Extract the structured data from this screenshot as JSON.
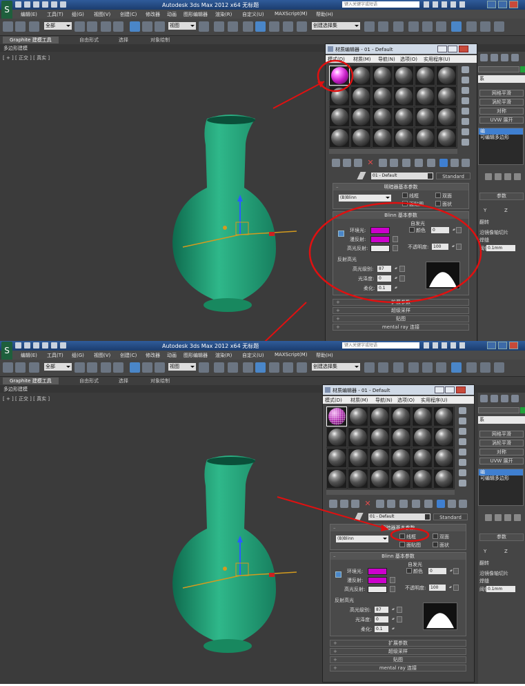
{
  "app_title": "Autodesk 3ds Max  2012 x64   无标题",
  "search_placeholder": "键入关键字或短语",
  "menu": [
    "编辑(E)",
    "工具(T)",
    "组(G)",
    "视图(V)",
    "创建(C)",
    "修改器",
    "动画",
    "图形编辑器",
    "渲染(R)",
    "自定义(U)",
    "MAXScript(M)",
    "帮助(H)"
  ],
  "toolbar": {
    "selection_filter": "全部",
    "ref_coord": "视图",
    "named_selection": "创建选择集"
  },
  "ribbon_tabs": [
    "Graphite 建模工具",
    "自由形式",
    "选择",
    "对象绘制"
  ],
  "ribbon_subtitle": "多边形建模",
  "viewport_label": "[ + ] [ 正交 ] [ 真实 ]",
  "material_editor": {
    "title": "材质编辑器 - 01 - Default",
    "menu": [
      "模式(D)",
      "材质(M)",
      "导航(N)",
      "选项(O)",
      "实用程序(U)"
    ],
    "material_name": "01 - Default",
    "material_type": "Standard",
    "shader_rollout": {
      "title": "明暗器基本参数",
      "shader": "(B)Blinn",
      "wire_label": "线框",
      "two_sided_label": "双面",
      "face_map_label": "面贴图",
      "faceted_label": "面状"
    },
    "blinn_rollout": {
      "title": "Blinn 基本参数",
      "self_illum_title": "自发光",
      "color_label": "颜色",
      "color_value": "0",
      "ambient_label": "环境光:",
      "diffuse_label": "漫反射:",
      "specular_label": "高光反射:",
      "opacity_label": "不透明度:",
      "opacity_value": "100",
      "highlight_title": "反射高光",
      "spec_level_label": "高光级别:",
      "spec_level_value": "87",
      "gloss_label": "光泽度:",
      "gloss_value": "0",
      "soften_label": "柔化:",
      "soften_value": "0.1"
    },
    "collapsed_rollouts": [
      "扩展参数",
      "超级采样",
      "贴图",
      "mental ray 连接"
    ]
  },
  "command_panel": {
    "modifier_list_label": "系",
    "buttons": [
      "网格平滑",
      "涡轮平滑",
      "对称",
      "UVW 展开"
    ],
    "stack_items": [
      "编",
      "可编辑多边形"
    ],
    "params_title": "参数",
    "axis_y": "Y",
    "axis_z": "Z",
    "flip_label": "翻转",
    "slice_label": "沿镜像轴切片",
    "weld_label": "焊缝",
    "threshold_label": "阈值",
    "threshold_value": "0.1mm"
  },
  "colors": {
    "vase": "#2fb88a",
    "ambient": "#cc00cc",
    "diffuse": "#cc00cc",
    "specular": "#e8e8e8",
    "annotation": "#e01010"
  }
}
